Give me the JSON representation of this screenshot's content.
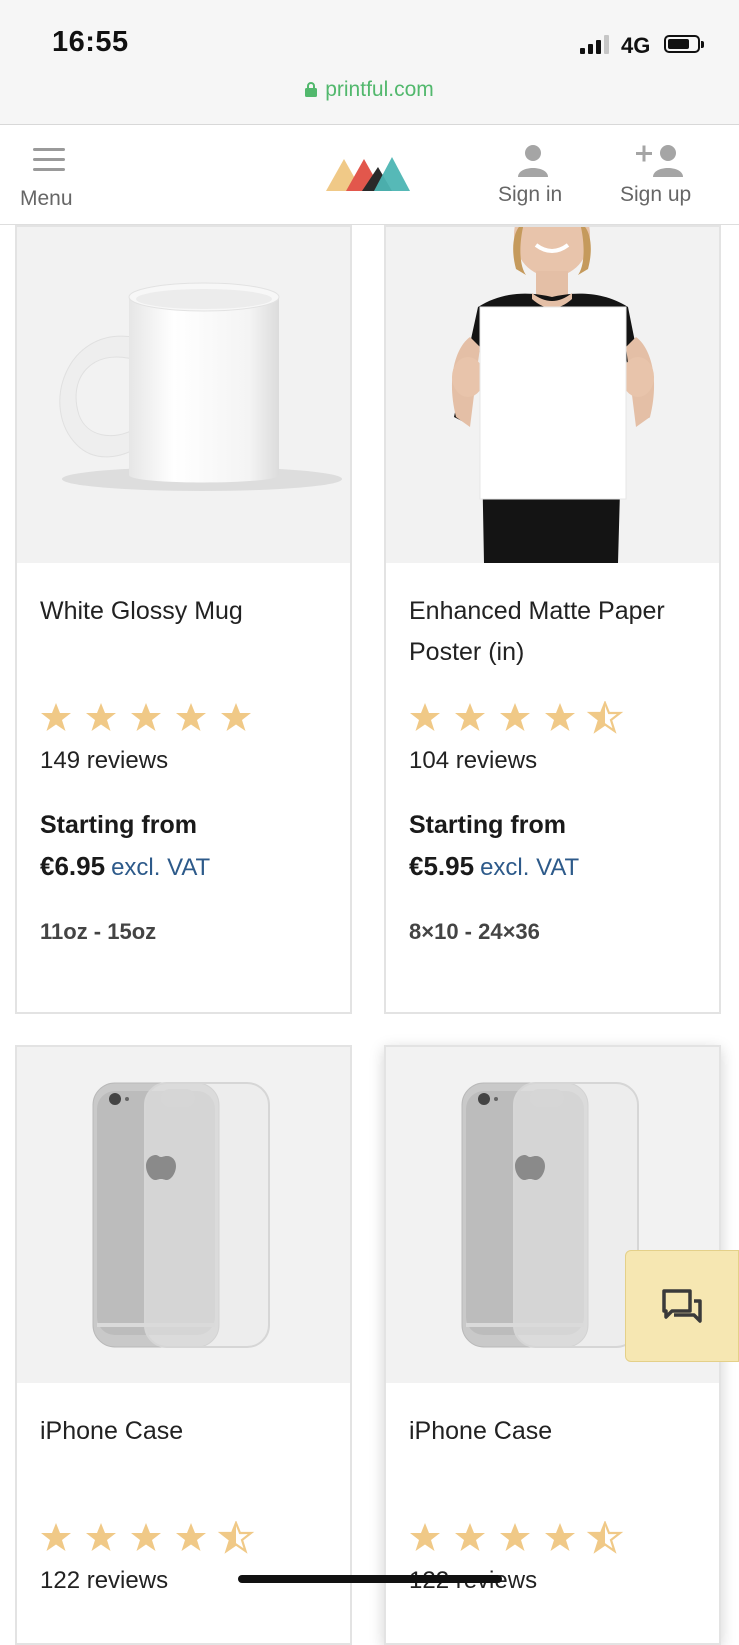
{
  "status_bar": {
    "time": "16:55",
    "network": "4G"
  },
  "browser": {
    "url": "printful.com"
  },
  "nav": {
    "menu_label": "Menu",
    "sign_in_label": "Sign in",
    "sign_up_label": "Sign up"
  },
  "products": [
    {
      "name": "White Glossy Mug",
      "rating": 5,
      "reviews": "149 reviews",
      "starting_label": "Starting from",
      "price": "€6.95",
      "vat": "excl. VAT",
      "sizes": "11oz - 15oz"
    },
    {
      "name": "Enhanced Matte Paper Poster (in)",
      "rating": 4.5,
      "reviews": "104 reviews",
      "starting_label": "Starting from",
      "price": "€5.95",
      "vat": "excl. VAT",
      "sizes": "8×10 - 24×36"
    },
    {
      "name": "iPhone Case",
      "rating": 4.5,
      "reviews": "122 reviews"
    },
    {
      "name": "iPhone Case",
      "rating": 4.5,
      "reviews": "122 reviews"
    }
  ],
  "colors": {
    "star": "#f0c987",
    "accent_green": "#52b86d",
    "vat_blue": "#2d5a8a",
    "chat_bg": "#f6e7b2"
  },
  "icons": {
    "menu": "hamburger-icon",
    "sign_in": "user-icon",
    "sign_up": "user-plus-icon",
    "chat": "chat-bubbles-icon",
    "lock": "lock-icon"
  }
}
